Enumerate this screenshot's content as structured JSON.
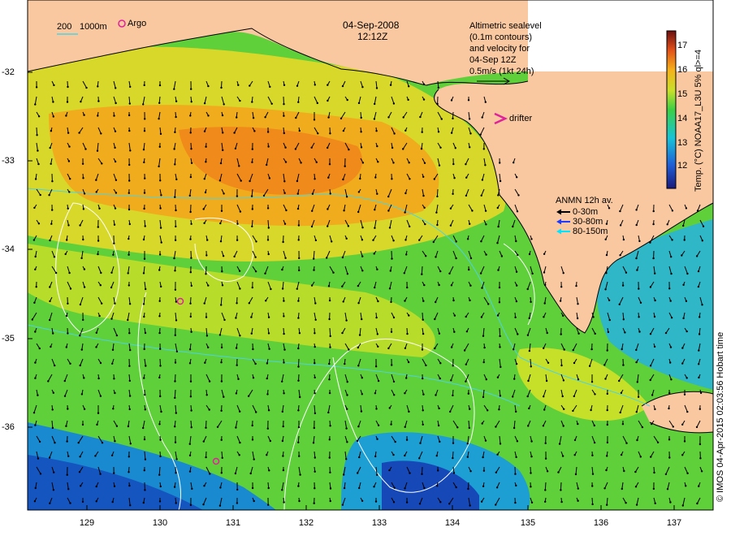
{
  "title": {
    "date": "04-Sep-2008",
    "time": "12:12Z"
  },
  "scale_legend": {
    "label_a": "200",
    "label_b": "1000m",
    "argo_label": "Argo"
  },
  "altimetry_note": {
    "line1": "Altimetric sealevel",
    "line2": "(0.1m contours)",
    "line3": "and velocity for",
    "line4": "04-Sep 12Z",
    "line5": "0.5m/s (1kt 24h)"
  },
  "drifter_label": "drifter",
  "mooring_legend": {
    "title": "ANMN 12h av.",
    "items": [
      {
        "label": "0-30m",
        "color": "#000000"
      },
      {
        "label": "30-80m",
        "color": "#1e3cff"
      },
      {
        "label": "80-150m",
        "color": "#00e5ff"
      }
    ]
  },
  "colorbar": {
    "title": "Temp. (°C) NOAA17_L3U 5% ql>=4",
    "ticks": [
      "17",
      "16",
      "15",
      "14",
      "13",
      "12"
    ],
    "range": [
      11.4,
      17.6
    ]
  },
  "axes": {
    "y_ticks": [
      "-32",
      "-33",
      "-34",
      "-35",
      "-36"
    ],
    "x_ticks": [
      "129",
      "130",
      "131",
      "132",
      "133",
      "134",
      "135",
      "136",
      "137"
    ]
  },
  "credit": "© IMOS 04-Apr-2015 02:03:56 Hobart time",
  "colors": {
    "land": "#f9c8a0",
    "sea_warm": "#f2a21a",
    "sea_mid": "#3fc23a",
    "sea_cool": "#1a7cd0",
    "argo_marker": "#e0229a"
  }
}
